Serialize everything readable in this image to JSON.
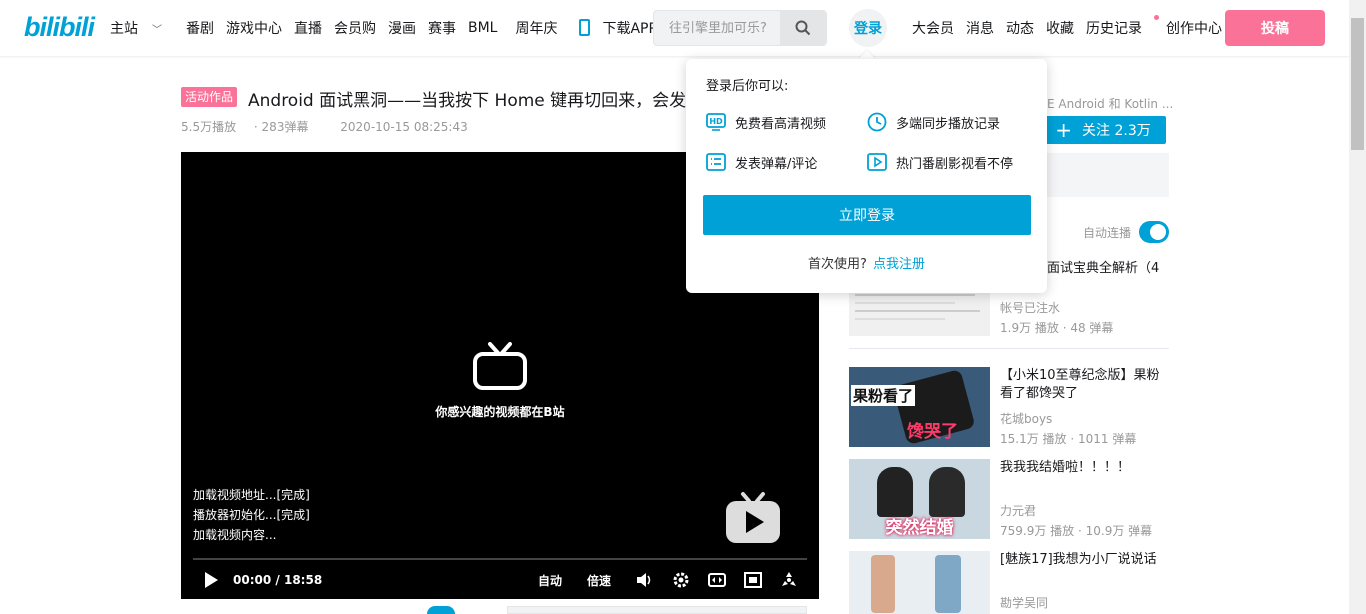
{
  "header": {
    "logo": "bilibili",
    "nav_left": [
      "主站",
      "番剧",
      "游戏中心",
      "直播",
      "会员购",
      "漫画",
      "赛事",
      "BML",
      "周年庆"
    ],
    "download": "下载APP",
    "search_placeholder": "往引擎里加可乐?",
    "login": "登录",
    "nav_right": [
      "大会员",
      "消息",
      "动态",
      "收藏",
      "历史记录",
      "创作中心"
    ],
    "upload": "投稿",
    "accent": "#00a1d6",
    "pink": "#fb7299"
  },
  "video": {
    "badge": "活动作品",
    "title": "Android 面试黑洞——当我按下 Home 键再切回来，会发",
    "views": "5.5万播放",
    "danmaku": "283弹幕",
    "date": "2020-10-15 08:25:43"
  },
  "player": {
    "slogan": "你感兴趣的视频都在B站",
    "log": [
      "加载视频地址...[完成]",
      "播放器初始化...[完成]",
      "加载视频内容..."
    ],
    "current_time": "00:00",
    "separator": "/",
    "duration": "18:58",
    "auto": "自动",
    "speed": "倍速"
  },
  "sidebar": {
    "author_snippet": "E Android 和 Kotlin ...",
    "follow": "关注 2.3万",
    "autoplay": "自动连播",
    "first_title_snippet": "面试宝典全解析（4",
    "recs": [
      {
        "title": "",
        "up": "帐号已注水",
        "stats": "1.9万 播放 · 48 弹幕"
      },
      {
        "title": "【小米10至尊纪念版】果粉看了都馋哭了",
        "up": "花城boys",
        "stats": "15.1万 播放 · 1011 弹幕",
        "thumb_text_1": "果粉看了",
        "thumb_text_2": "馋哭了"
      },
      {
        "title": "我我我结婚啦！！！！",
        "up": "力元君",
        "stats": "759.9万 播放 · 10.9万 弹幕",
        "thumb_text": "突然结婚"
      },
      {
        "title": "[魅族17]我想为小厂说说话",
        "up": "勘学吴同",
        "stats": ""
      }
    ]
  },
  "popup": {
    "heading": "登录后你可以:",
    "perks": [
      "免费看高清视频",
      "多端同步播放记录",
      "发表弹幕/评论",
      "热门番剧影视看不停"
    ],
    "login_button": "立即登录",
    "first_use": "首次使用?",
    "register": "点我注册"
  }
}
